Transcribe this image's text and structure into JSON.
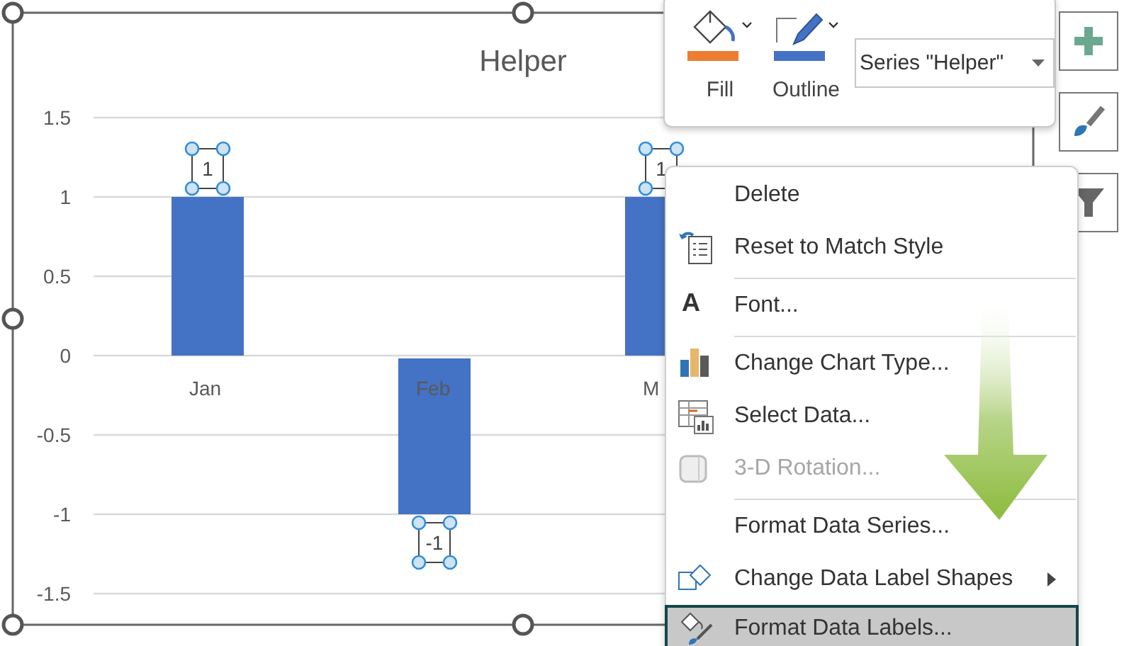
{
  "chart": {
    "labels_selected": true,
    "chart_data": {
      "type": "bar",
      "title": "Helper",
      "categories": [
        "Jan",
        "Feb",
        "M"
      ],
      "series": [
        {
          "color": "#4472c4",
          "values": [
            1,
            -1,
            1
          ]
        }
      ],
      "grid": true,
      "ylim": [
        -1.5,
        1.5
      ],
      "yticks": [
        1.5,
        1,
        0.5,
        0,
        -0.5,
        -1,
        -1.5
      ],
      "data_labels": true
    }
  },
  "format_toolbar": {
    "buttons": [
      {
        "label": "Fill",
        "color": "#ed7d31"
      },
      {
        "label": "Outline",
        "color": "#4472c4"
      }
    ],
    "element_select": {
      "value": "Series \"Helper\""
    }
  },
  "context_menu": {
    "items": [
      {
        "label": "Delete",
        "disabled": false,
        "selected": false,
        "submenu": false,
        "separator_before": false
      },
      {
        "label": "Reset to Match Style",
        "disabled": false,
        "selected": false,
        "submenu": false,
        "separator_before": false
      },
      {
        "label": "Font...",
        "glyph": "A",
        "disabled": false,
        "selected": false,
        "submenu": false,
        "separator_before": true
      },
      {
        "label": "Change Chart Type...",
        "disabled": false,
        "selected": false,
        "submenu": false,
        "separator_before": true
      },
      {
        "label": "Select Data...",
        "disabled": false,
        "selected": false,
        "submenu": false,
        "separator_before": false
      },
      {
        "label": "3-D Rotation...",
        "disabled": true,
        "selected": false,
        "submenu": false,
        "separator_before": false
      },
      {
        "label": "Format Data Series...",
        "disabled": false,
        "selected": false,
        "submenu": false,
        "separator_before": true
      },
      {
        "label": "Change Data Label Shapes",
        "disabled": false,
        "selected": false,
        "submenu": true,
        "separator_before": false
      },
      {
        "label": "Format Data Labels...",
        "disabled": false,
        "selected": true,
        "submenu": false,
        "separator_before": false
      }
    ]
  }
}
